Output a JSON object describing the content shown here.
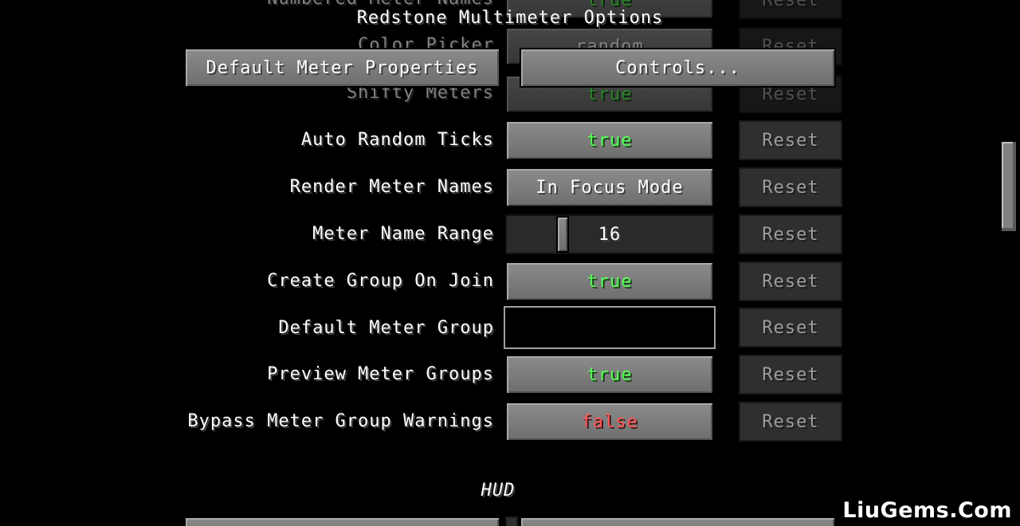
{
  "window": {
    "title": "Redstone Multimeter Options"
  },
  "top_buttons": {
    "default_meter_properties": "Default Meter Properties",
    "controls": "Controls..."
  },
  "faded_rows": [
    {
      "label": "Numbered Meter Names",
      "value": "true",
      "reset": "Reset"
    },
    {
      "label": "Color Picker",
      "value": "random",
      "reset": "Reset"
    },
    {
      "label": "Shifty Meters",
      "value": "true",
      "reset": "Reset"
    }
  ],
  "rows": [
    {
      "label": "Auto Random Ticks",
      "value": "true",
      "reset": "Reset"
    },
    {
      "label": "Render Meter Names",
      "value": "In Focus Mode",
      "reset": "Reset"
    },
    {
      "label": "Meter Name Range",
      "value": "16",
      "reset": "Reset"
    },
    {
      "label": "Create Group On Join",
      "value": "true",
      "reset": "Reset"
    },
    {
      "label": "Default Meter Group",
      "value": "",
      "reset": "Reset"
    },
    {
      "label": "Preview Meter Groups",
      "value": "true",
      "reset": "Reset"
    },
    {
      "label": "Bypass Meter Group Warnings",
      "value": "false",
      "reset": "Reset"
    }
  ],
  "section": {
    "hud": "HUD"
  },
  "watermark": "LiuGems.Com",
  "colors": {
    "true": "#55ff55",
    "false": "#ff5555",
    "button": "#7b7b7b",
    "disabled": "#2f2f2f"
  }
}
